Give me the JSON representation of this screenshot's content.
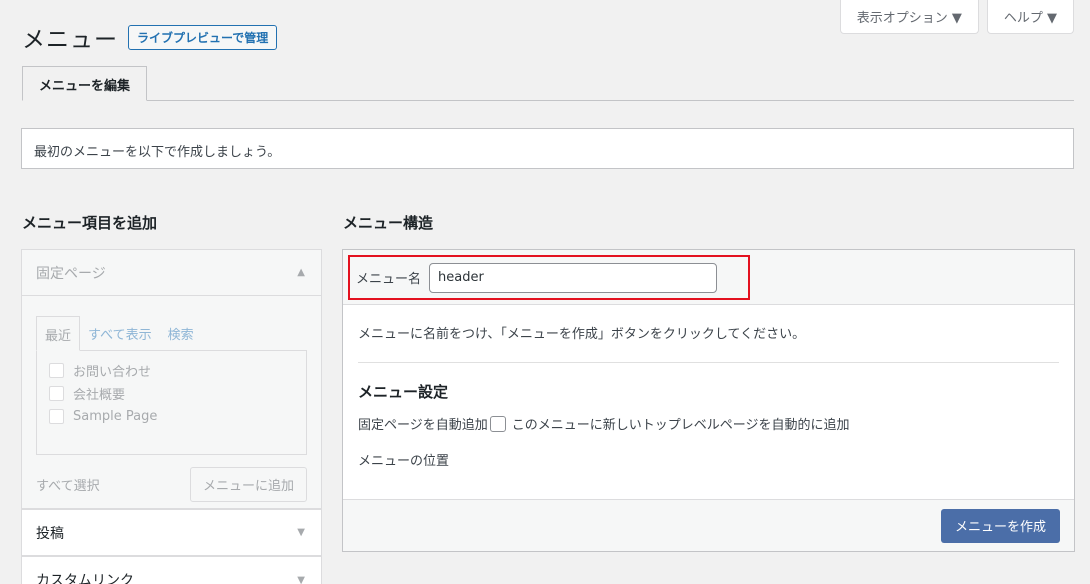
{
  "screen_meta": {
    "options_label": "表示オプション ▼",
    "help_label": "ヘルプ ▼"
  },
  "page": {
    "title": "メニュー",
    "live_preview_label": "ライブプレビューで管理"
  },
  "tabs": {
    "edit_label": "メニューを編集"
  },
  "notice": {
    "text": "最初のメニューを以下で作成しましょう。"
  },
  "left": {
    "title": "メニュー項目を追加",
    "sections": [
      {
        "label": "固定ページ"
      },
      {
        "label": "投稿"
      },
      {
        "label": "カスタムリンク"
      }
    ],
    "inner_tabs": [
      "最近",
      "すべて表示",
      "検索"
    ],
    "pages": [
      "お問い合わせ",
      "会社概要",
      "Sample Page"
    ],
    "select_all": "すべて選択",
    "add_to_menu": "メニューに追加"
  },
  "right": {
    "title": "メニュー構造",
    "name_label": "メニュー名",
    "name_value": "header",
    "instruction": "メニューに名前をつけ、「メニューを作成」ボタンをクリックしてください。",
    "settings_title": "メニュー設定",
    "auto_add_label": "固定ページを自動追加",
    "auto_add_desc": "このメニューに新しいトップレベルページを自動的に追加",
    "location_label": "メニューの位置",
    "create_button": "メニューを作成"
  },
  "colors": {
    "highlight_border": "#e3111f",
    "primary_button": "#4b6ea8",
    "link": "#2271b1"
  }
}
